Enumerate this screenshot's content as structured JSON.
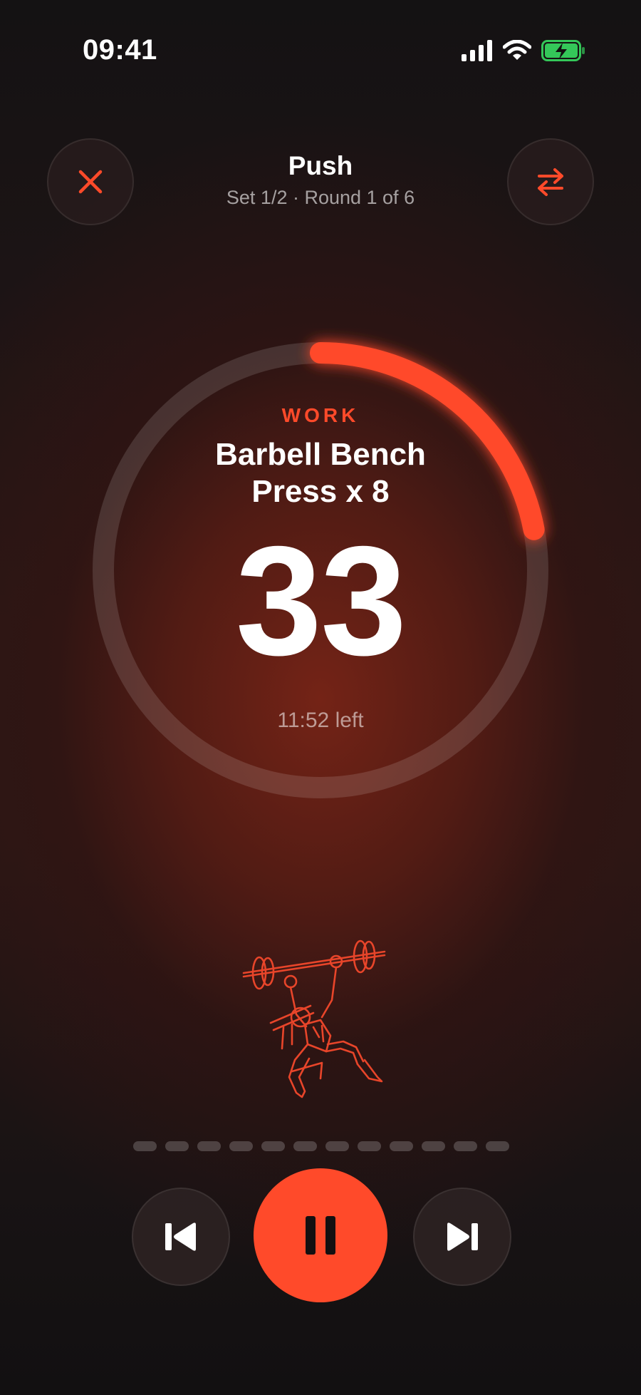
{
  "status_bar": {
    "time": "09:41"
  },
  "header": {
    "title": "Push",
    "subtitle": "Set 1/2 · Round 1 of 6",
    "close_icon": "close-icon",
    "swap_icon": "swap-arrows-icon"
  },
  "timer": {
    "phase": "WORK",
    "exercise_line1": "Barbell Bench",
    "exercise_line2": "Press x 8",
    "count": "33",
    "time_left": "11:52 left",
    "progress_fraction": 0.22
  },
  "progress_dashes": {
    "total": 12
  },
  "controls": {
    "prev_icon": "skip-previous-icon",
    "pause_icon": "pause-icon",
    "next_icon": "skip-next-icon"
  },
  "colors": {
    "accent": "#ff4a2a",
    "battery": "#34c759",
    "ring_track": "#5a3530"
  }
}
